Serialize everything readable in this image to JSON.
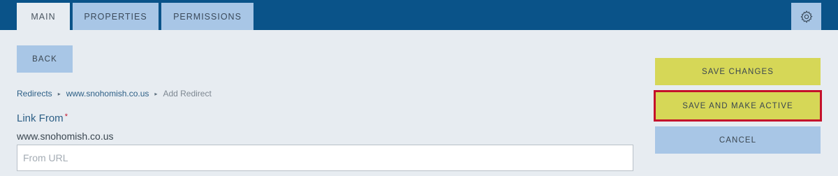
{
  "tabs": [
    {
      "label": "MAIN",
      "active": true
    },
    {
      "label": "PROPERTIES",
      "active": false
    },
    {
      "label": "PERMISSIONS",
      "active": false
    }
  ],
  "settings_icon": "gear-icon",
  "back_button": "BACK",
  "breadcrumb": {
    "items": [
      "Redirects",
      "www.snohomish.co.us"
    ],
    "current": "Add Redirect",
    "separator": "▸"
  },
  "link_from": {
    "label": "Link From",
    "required_mark": "*",
    "domain": "www.snohomish.co.us",
    "placeholder": "From URL",
    "value": ""
  },
  "actions": {
    "save": "SAVE CHANGES",
    "save_active": "SAVE AND MAKE ACTIVE",
    "cancel": "CANCEL"
  },
  "colors": {
    "header": "#0a5389",
    "tab": "#a8c6e6",
    "save": "#d6d757",
    "highlight_border": "#c4112b"
  }
}
